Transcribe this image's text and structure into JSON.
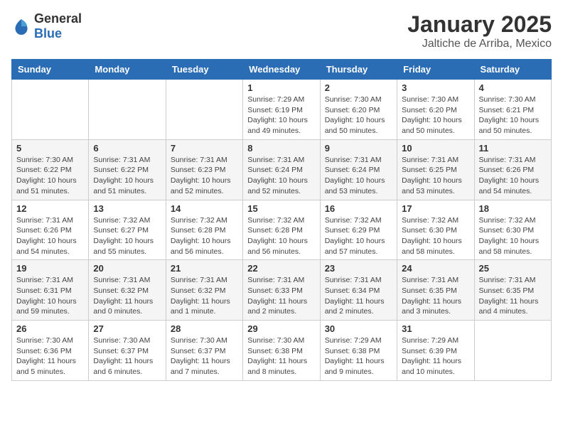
{
  "logo": {
    "general": "General",
    "blue": "Blue"
  },
  "header": {
    "month": "January 2025",
    "location": "Jaltiche de Arriba, Mexico"
  },
  "weekdays": [
    "Sunday",
    "Monday",
    "Tuesday",
    "Wednesday",
    "Thursday",
    "Friday",
    "Saturday"
  ],
  "weeks": [
    [
      {
        "day": "",
        "info": ""
      },
      {
        "day": "",
        "info": ""
      },
      {
        "day": "",
        "info": ""
      },
      {
        "day": "1",
        "info": "Sunrise: 7:29 AM\nSunset: 6:19 PM\nDaylight: 10 hours and 49 minutes."
      },
      {
        "day": "2",
        "info": "Sunrise: 7:30 AM\nSunset: 6:20 PM\nDaylight: 10 hours and 50 minutes."
      },
      {
        "day": "3",
        "info": "Sunrise: 7:30 AM\nSunset: 6:20 PM\nDaylight: 10 hours and 50 minutes."
      },
      {
        "day": "4",
        "info": "Sunrise: 7:30 AM\nSunset: 6:21 PM\nDaylight: 10 hours and 50 minutes."
      }
    ],
    [
      {
        "day": "5",
        "info": "Sunrise: 7:30 AM\nSunset: 6:22 PM\nDaylight: 10 hours and 51 minutes."
      },
      {
        "day": "6",
        "info": "Sunrise: 7:31 AM\nSunset: 6:22 PM\nDaylight: 10 hours and 51 minutes."
      },
      {
        "day": "7",
        "info": "Sunrise: 7:31 AM\nSunset: 6:23 PM\nDaylight: 10 hours and 52 minutes."
      },
      {
        "day": "8",
        "info": "Sunrise: 7:31 AM\nSunset: 6:24 PM\nDaylight: 10 hours and 52 minutes."
      },
      {
        "day": "9",
        "info": "Sunrise: 7:31 AM\nSunset: 6:24 PM\nDaylight: 10 hours and 53 minutes."
      },
      {
        "day": "10",
        "info": "Sunrise: 7:31 AM\nSunset: 6:25 PM\nDaylight: 10 hours and 53 minutes."
      },
      {
        "day": "11",
        "info": "Sunrise: 7:31 AM\nSunset: 6:26 PM\nDaylight: 10 hours and 54 minutes."
      }
    ],
    [
      {
        "day": "12",
        "info": "Sunrise: 7:31 AM\nSunset: 6:26 PM\nDaylight: 10 hours and 54 minutes."
      },
      {
        "day": "13",
        "info": "Sunrise: 7:32 AM\nSunset: 6:27 PM\nDaylight: 10 hours and 55 minutes."
      },
      {
        "day": "14",
        "info": "Sunrise: 7:32 AM\nSunset: 6:28 PM\nDaylight: 10 hours and 56 minutes."
      },
      {
        "day": "15",
        "info": "Sunrise: 7:32 AM\nSunset: 6:28 PM\nDaylight: 10 hours and 56 minutes."
      },
      {
        "day": "16",
        "info": "Sunrise: 7:32 AM\nSunset: 6:29 PM\nDaylight: 10 hours and 57 minutes."
      },
      {
        "day": "17",
        "info": "Sunrise: 7:32 AM\nSunset: 6:30 PM\nDaylight: 10 hours and 58 minutes."
      },
      {
        "day": "18",
        "info": "Sunrise: 7:32 AM\nSunset: 6:30 PM\nDaylight: 10 hours and 58 minutes."
      }
    ],
    [
      {
        "day": "19",
        "info": "Sunrise: 7:31 AM\nSunset: 6:31 PM\nDaylight: 10 hours and 59 minutes."
      },
      {
        "day": "20",
        "info": "Sunrise: 7:31 AM\nSunset: 6:32 PM\nDaylight: 11 hours and 0 minutes."
      },
      {
        "day": "21",
        "info": "Sunrise: 7:31 AM\nSunset: 6:32 PM\nDaylight: 11 hours and 1 minute."
      },
      {
        "day": "22",
        "info": "Sunrise: 7:31 AM\nSunset: 6:33 PM\nDaylight: 11 hours and 2 minutes."
      },
      {
        "day": "23",
        "info": "Sunrise: 7:31 AM\nSunset: 6:34 PM\nDaylight: 11 hours and 2 minutes."
      },
      {
        "day": "24",
        "info": "Sunrise: 7:31 AM\nSunset: 6:35 PM\nDaylight: 11 hours and 3 minutes."
      },
      {
        "day": "25",
        "info": "Sunrise: 7:31 AM\nSunset: 6:35 PM\nDaylight: 11 hours and 4 minutes."
      }
    ],
    [
      {
        "day": "26",
        "info": "Sunrise: 7:30 AM\nSunset: 6:36 PM\nDaylight: 11 hours and 5 minutes."
      },
      {
        "day": "27",
        "info": "Sunrise: 7:30 AM\nSunset: 6:37 PM\nDaylight: 11 hours and 6 minutes."
      },
      {
        "day": "28",
        "info": "Sunrise: 7:30 AM\nSunset: 6:37 PM\nDaylight: 11 hours and 7 minutes."
      },
      {
        "day": "29",
        "info": "Sunrise: 7:30 AM\nSunset: 6:38 PM\nDaylight: 11 hours and 8 minutes."
      },
      {
        "day": "30",
        "info": "Sunrise: 7:29 AM\nSunset: 6:38 PM\nDaylight: 11 hours and 9 minutes."
      },
      {
        "day": "31",
        "info": "Sunrise: 7:29 AM\nSunset: 6:39 PM\nDaylight: 11 hours and 10 minutes."
      },
      {
        "day": "",
        "info": ""
      }
    ]
  ]
}
